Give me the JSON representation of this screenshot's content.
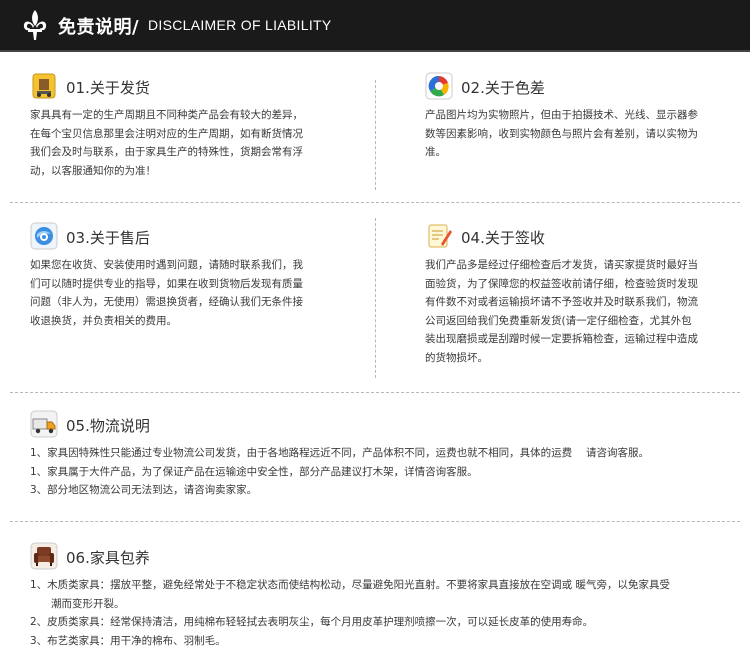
{
  "header": {
    "title": "免责说明/",
    "subtitle": "DISCLAIMER OF LIABILITY"
  },
  "sections": [
    {
      "title": "01.关于发货",
      "icon": "shipping-box-icon",
      "lines": [
        "家具具有一定的生产周期且不同种类产品会有较大的差异，",
        "在每个宝贝信息那里会注明对应的生产周期，如有断货情况",
        "我们会及时与联系，由于家具生产的特殊性，货期会常有浮",
        "动，以客服通知你的为准！"
      ]
    },
    {
      "title": "02.关于色差",
      "icon": "color-wheel-icon",
      "lines": [
        "产品图片均为实物照片，但由于拍摄技术、光线、显示器参",
        "数等因素影响，收到实物颜色与照片会有差别，请以实物为",
        "准。"
      ]
    },
    {
      "title": "03.关于售后",
      "icon": "support-globe-icon",
      "lines": [
        "如果您在收货、安装使用时遇到问题，请随时联系我们，我",
        "们可以随时提供专业的指导，如果在收到货物后发现有质量",
        "问题（非人为，无使用）需退换货者，经确认我们无条件接",
        "收退换货，并负责相关的费用。"
      ]
    },
    {
      "title": "04.关于签收",
      "icon": "sign-pen-icon",
      "lines": [
        "我们产品多是经过仔细检查后才发货，请买家提货时最好当",
        "面验货，为了保障您的权益签收前请仔细，检查验货时发现",
        "有件数不对或者运输损坏请不予签收并及时联系我们，物流",
        "公司返回给我们免费重新发货(请一定仔细检查，尤其外包",
        "装出现磨损或是刮蹭时候一定要拆箱检查，运输过程中造成",
        "的货物损坏。"
      ]
    },
    {
      "title": "05.物流说明",
      "icon": "delivery-truck-icon",
      "lines": [
        "1、家具因特殊性只能通过专业物流公司发货，由于各地路程远近不同，产品体积不同，运费也就不相同，具体的运费　 请咨询客服。",
        "1、家具属于大件产品，为了保证产品在运输途中安全性，部分产品建议打木架，详情咨询客服。",
        "3、部分地区物流公司无法到达，请咨询卖家家。"
      ]
    },
    {
      "title": "06.家具包养",
      "icon": "armchair-icon",
      "lines": [
        "1、木质类家具：摆放平整，避免经常处于不稳定状态而使结构松动，尽量避免阳光直射。不要将家具直接放在空调或 暖气旁，以免家具受",
        "　　潮而变形开裂。",
        "2、皮质类家具：经常保持清洁，用纯棉布轻轻拭去表明灰尘，每个月用皮革护理剂喷擦一次，可以延长皮革的使用寿命。",
        "3、布艺类家具：用干净的棉布、羽制毛。"
      ]
    }
  ]
}
